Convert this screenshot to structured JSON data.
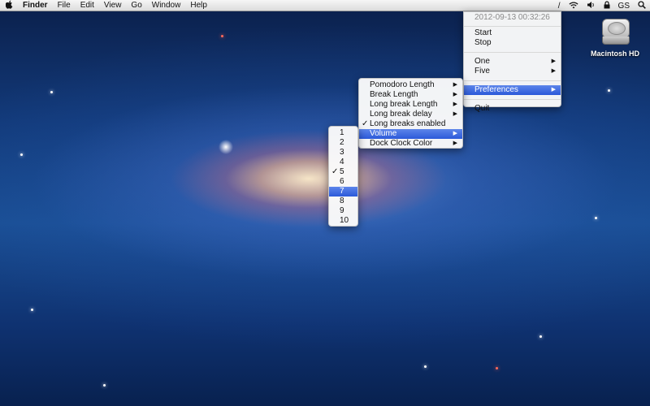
{
  "menubar": {
    "apple": "",
    "items": [
      "Finder",
      "File",
      "Edit",
      "View",
      "Go",
      "Window",
      "Help"
    ],
    "status": {
      "timer_glyph": "/",
      "wifi": "wifi-icon",
      "volume": "volume-icon",
      "lock": "lock-icon",
      "user": "GS",
      "search": "search-icon"
    }
  },
  "app_menu": {
    "timestamp": "2012-09-13 00:32:26",
    "items": [
      "Start",
      "Stop",
      "One",
      "Five",
      "Preferences",
      "Quit"
    ]
  },
  "prefs_menu": {
    "items": [
      "Pomodoro Length",
      "Break Length",
      "Long break Length",
      "Long break delay",
      "Long breaks enabled",
      "Volume",
      "Dock Clock Color"
    ],
    "checked": "Long breaks enabled",
    "highlighted": "Volume"
  },
  "volume_menu": {
    "items": [
      "1",
      "2",
      "3",
      "4",
      "5",
      "6",
      "7",
      "8",
      "9",
      "10"
    ],
    "checked": "5",
    "highlighted": "7"
  },
  "desktop": {
    "hd_label": "Macintosh HD"
  },
  "glyphs": {
    "arrow": "▶",
    "check": "✓"
  }
}
